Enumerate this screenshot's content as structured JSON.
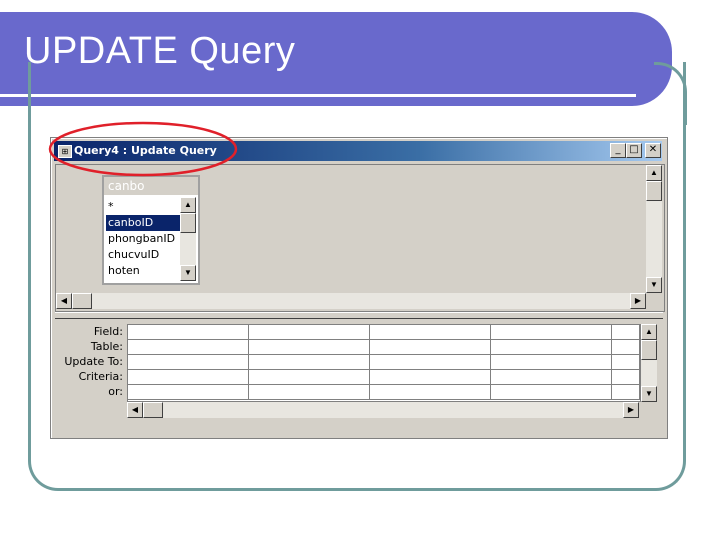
{
  "slide": {
    "title": "UPDATE Query"
  },
  "window": {
    "title": "Query4 : Update Query",
    "buttons": {
      "minimize": "_",
      "maximize": "□",
      "close": "✕"
    }
  },
  "table_box": {
    "name": "canbo",
    "fields": [
      "*",
      "canboID",
      "phongbanID",
      "chucvuID",
      "hoten"
    ],
    "selected_index": 1
  },
  "design_grid": {
    "row_labels": [
      "Field:",
      "Table:",
      "Update To:",
      "Criteria:",
      "or:"
    ]
  },
  "colors": {
    "banner": "#6969cc",
    "frame": "#6f9c9c",
    "highlight_ellipse": "#e0202a",
    "titlebar": "#0a246a"
  }
}
